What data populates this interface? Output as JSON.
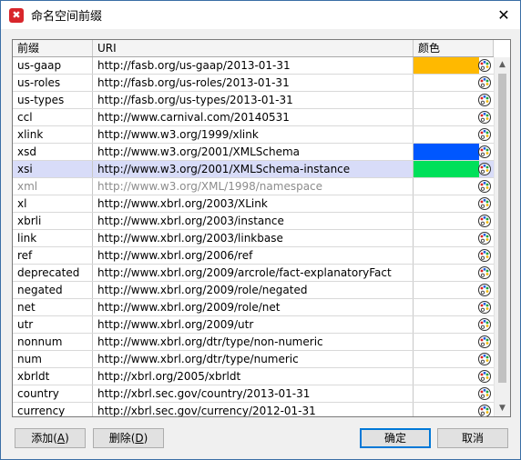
{
  "window": {
    "title": "命名空间前缀",
    "app_icon_glyph": "✖",
    "close_glyph": "✕"
  },
  "table": {
    "headers": {
      "prefix": "前缀",
      "uri": "URI",
      "color": "颜色"
    },
    "rows": [
      {
        "prefix": "us-gaap",
        "uri": "http://fasb.org/us-gaap/2013-01-31",
        "color": "#ffb900"
      },
      {
        "prefix": "us-roles",
        "uri": "http://fasb.org/us-roles/2013-01-31",
        "color": ""
      },
      {
        "prefix": "us-types",
        "uri": "http://fasb.org/us-types/2013-01-31",
        "color": ""
      },
      {
        "prefix": "ccl",
        "uri": "http://www.carnival.com/20140531",
        "color": ""
      },
      {
        "prefix": "xlink",
        "uri": "http://www.w3.org/1999/xlink",
        "color": ""
      },
      {
        "prefix": "xsd",
        "uri": "http://www.w3.org/2001/XMLSchema",
        "color": "#0057ff"
      },
      {
        "prefix": "xsi",
        "uri": "http://www.w3.org/2001/XMLSchema-instance",
        "color": "#00e05a",
        "selected": true
      },
      {
        "prefix": "xml",
        "uri": "http://www.w3.org/XML/1998/namespace",
        "color": "",
        "dim": true
      },
      {
        "prefix": "xl",
        "uri": "http://www.xbrl.org/2003/XLink",
        "color": ""
      },
      {
        "prefix": "xbrli",
        "uri": "http://www.xbrl.org/2003/instance",
        "color": ""
      },
      {
        "prefix": "link",
        "uri": "http://www.xbrl.org/2003/linkbase",
        "color": ""
      },
      {
        "prefix": "ref",
        "uri": "http://www.xbrl.org/2006/ref",
        "color": ""
      },
      {
        "prefix": "deprecated",
        "uri": "http://www.xbrl.org/2009/arcrole/fact-explanatoryFact",
        "color": ""
      },
      {
        "prefix": "negated",
        "uri": "http://www.xbrl.org/2009/role/negated",
        "color": ""
      },
      {
        "prefix": "net",
        "uri": "http://www.xbrl.org/2009/role/net",
        "color": ""
      },
      {
        "prefix": "utr",
        "uri": "http://www.xbrl.org/2009/utr",
        "color": ""
      },
      {
        "prefix": "nonnum",
        "uri": "http://www.xbrl.org/dtr/type/non-numeric",
        "color": ""
      },
      {
        "prefix": "num",
        "uri": "http://www.xbrl.org/dtr/type/numeric",
        "color": ""
      },
      {
        "prefix": "xbrldt",
        "uri": "http://xbrl.org/2005/xbrldt",
        "color": ""
      },
      {
        "prefix": "country",
        "uri": "http://xbrl.sec.gov/country/2013-01-31",
        "color": ""
      },
      {
        "prefix": "currency",
        "uri": "http://xbrl.sec.gov/currency/2012-01-31",
        "color": ""
      }
    ]
  },
  "scrollbar": {
    "up_glyph": "▲",
    "down_glyph": "▼"
  },
  "buttons": {
    "add": {
      "label": "添加(",
      "mnemonic": "A",
      "suffix": ")"
    },
    "delete": {
      "label": "删除(",
      "mnemonic": "D",
      "suffix": ")"
    },
    "ok": "确定",
    "cancel": "取消"
  }
}
